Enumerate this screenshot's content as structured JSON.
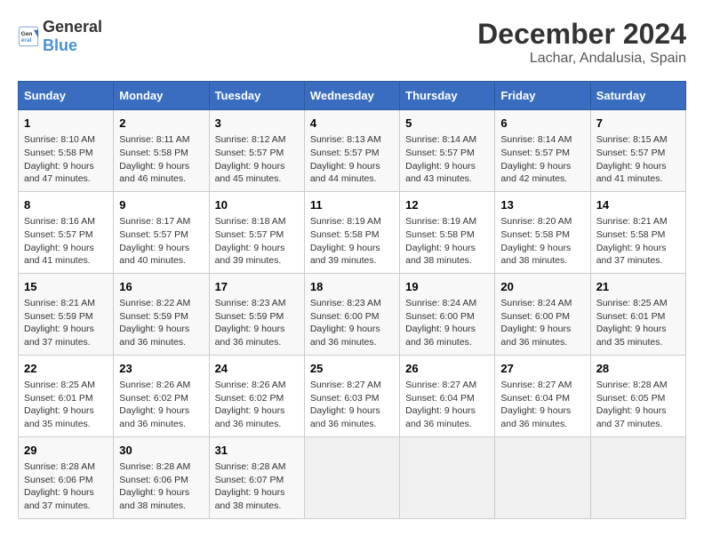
{
  "logo": {
    "text_general": "General",
    "text_blue": "Blue"
  },
  "header": {
    "month": "December 2024",
    "location": "Lachar, Andalusia, Spain"
  },
  "days_of_week": [
    "Sunday",
    "Monday",
    "Tuesday",
    "Wednesday",
    "Thursday",
    "Friday",
    "Saturday"
  ],
  "weeks": [
    [
      {
        "day": "1",
        "info": "Sunrise: 8:10 AM\nSunset: 5:58 PM\nDaylight: 9 hours\nand 47 minutes."
      },
      {
        "day": "2",
        "info": "Sunrise: 8:11 AM\nSunset: 5:58 PM\nDaylight: 9 hours\nand 46 minutes."
      },
      {
        "day": "3",
        "info": "Sunrise: 8:12 AM\nSunset: 5:57 PM\nDaylight: 9 hours\nand 45 minutes."
      },
      {
        "day": "4",
        "info": "Sunrise: 8:13 AM\nSunset: 5:57 PM\nDaylight: 9 hours\nand 44 minutes."
      },
      {
        "day": "5",
        "info": "Sunrise: 8:14 AM\nSunset: 5:57 PM\nDaylight: 9 hours\nand 43 minutes."
      },
      {
        "day": "6",
        "info": "Sunrise: 8:14 AM\nSunset: 5:57 PM\nDaylight: 9 hours\nand 42 minutes."
      },
      {
        "day": "7",
        "info": "Sunrise: 8:15 AM\nSunset: 5:57 PM\nDaylight: 9 hours\nand 41 minutes."
      }
    ],
    [
      {
        "day": "8",
        "info": "Sunrise: 8:16 AM\nSunset: 5:57 PM\nDaylight: 9 hours\nand 41 minutes."
      },
      {
        "day": "9",
        "info": "Sunrise: 8:17 AM\nSunset: 5:57 PM\nDaylight: 9 hours\nand 40 minutes."
      },
      {
        "day": "10",
        "info": "Sunrise: 8:18 AM\nSunset: 5:57 PM\nDaylight: 9 hours\nand 39 minutes."
      },
      {
        "day": "11",
        "info": "Sunrise: 8:19 AM\nSunset: 5:58 PM\nDaylight: 9 hours\nand 39 minutes."
      },
      {
        "day": "12",
        "info": "Sunrise: 8:19 AM\nSunset: 5:58 PM\nDaylight: 9 hours\nand 38 minutes."
      },
      {
        "day": "13",
        "info": "Sunrise: 8:20 AM\nSunset: 5:58 PM\nDaylight: 9 hours\nand 38 minutes."
      },
      {
        "day": "14",
        "info": "Sunrise: 8:21 AM\nSunset: 5:58 PM\nDaylight: 9 hours\nand 37 minutes."
      }
    ],
    [
      {
        "day": "15",
        "info": "Sunrise: 8:21 AM\nSunset: 5:59 PM\nDaylight: 9 hours\nand 37 minutes."
      },
      {
        "day": "16",
        "info": "Sunrise: 8:22 AM\nSunset: 5:59 PM\nDaylight: 9 hours\nand 36 minutes."
      },
      {
        "day": "17",
        "info": "Sunrise: 8:23 AM\nSunset: 5:59 PM\nDaylight: 9 hours\nand 36 minutes."
      },
      {
        "day": "18",
        "info": "Sunrise: 8:23 AM\nSunset: 6:00 PM\nDaylight: 9 hours\nand 36 minutes."
      },
      {
        "day": "19",
        "info": "Sunrise: 8:24 AM\nSunset: 6:00 PM\nDaylight: 9 hours\nand 36 minutes."
      },
      {
        "day": "20",
        "info": "Sunrise: 8:24 AM\nSunset: 6:00 PM\nDaylight: 9 hours\nand 36 minutes."
      },
      {
        "day": "21",
        "info": "Sunrise: 8:25 AM\nSunset: 6:01 PM\nDaylight: 9 hours\nand 35 minutes."
      }
    ],
    [
      {
        "day": "22",
        "info": "Sunrise: 8:25 AM\nSunset: 6:01 PM\nDaylight: 9 hours\nand 35 minutes."
      },
      {
        "day": "23",
        "info": "Sunrise: 8:26 AM\nSunset: 6:02 PM\nDaylight: 9 hours\nand 36 minutes."
      },
      {
        "day": "24",
        "info": "Sunrise: 8:26 AM\nSunset: 6:02 PM\nDaylight: 9 hours\nand 36 minutes."
      },
      {
        "day": "25",
        "info": "Sunrise: 8:27 AM\nSunset: 6:03 PM\nDaylight: 9 hours\nand 36 minutes."
      },
      {
        "day": "26",
        "info": "Sunrise: 8:27 AM\nSunset: 6:04 PM\nDaylight: 9 hours\nand 36 minutes."
      },
      {
        "day": "27",
        "info": "Sunrise: 8:27 AM\nSunset: 6:04 PM\nDaylight: 9 hours\nand 36 minutes."
      },
      {
        "day": "28",
        "info": "Sunrise: 8:28 AM\nSunset: 6:05 PM\nDaylight: 9 hours\nand 37 minutes."
      }
    ],
    [
      {
        "day": "29",
        "info": "Sunrise: 8:28 AM\nSunset: 6:06 PM\nDaylight: 9 hours\nand 37 minutes."
      },
      {
        "day": "30",
        "info": "Sunrise: 8:28 AM\nSunset: 6:06 PM\nDaylight: 9 hours\nand 38 minutes."
      },
      {
        "day": "31",
        "info": "Sunrise: 8:28 AM\nSunset: 6:07 PM\nDaylight: 9 hours\nand 38 minutes."
      },
      null,
      null,
      null,
      null
    ]
  ]
}
